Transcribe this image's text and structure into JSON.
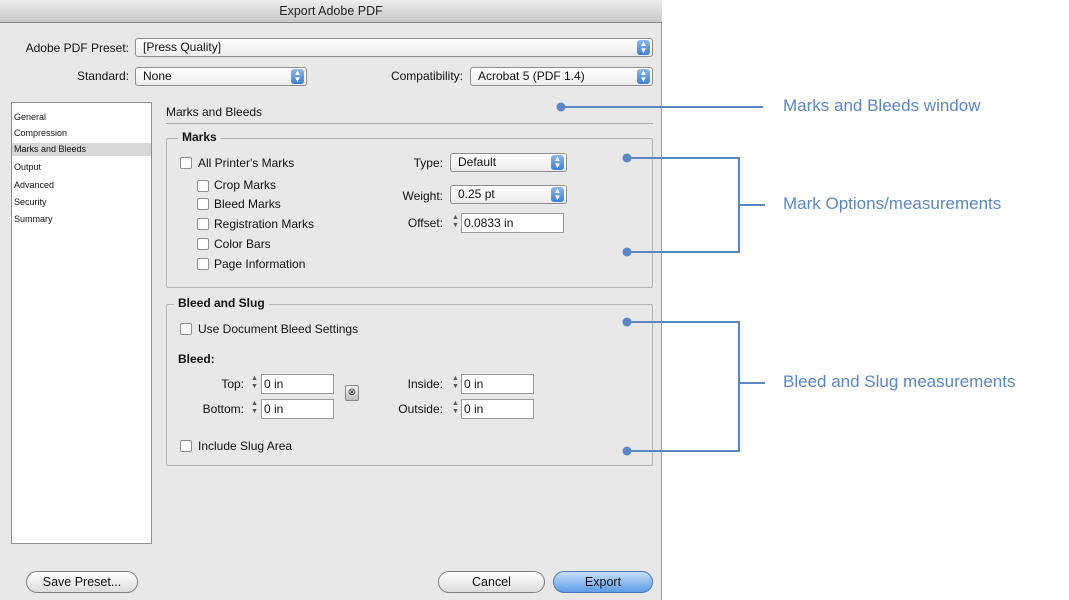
{
  "window": {
    "title": "Export Adobe PDF"
  },
  "preset": {
    "label": "Adobe PDF Preset:",
    "value": "[Press Quality]"
  },
  "standard": {
    "label": "Standard:",
    "value": "None"
  },
  "compatibility": {
    "label": "Compatibility:",
    "value": "Acrobat 5 (PDF 1.4)"
  },
  "sidebar": {
    "items": [
      {
        "label": "General"
      },
      {
        "label": "Compression"
      },
      {
        "label": "Marks and Bleeds"
      },
      {
        "label": "Output"
      },
      {
        "label": "Advanced"
      },
      {
        "label": "Security"
      },
      {
        "label": "Summary"
      }
    ]
  },
  "panel": {
    "title": "Marks and Bleeds"
  },
  "marks": {
    "group_title": "Marks",
    "all_printers_marks": "All Printer's Marks",
    "crop_marks": "Crop Marks",
    "bleed_marks": "Bleed Marks",
    "registration_marks": "Registration Marks",
    "color_bars": "Color Bars",
    "page_information": "Page Information",
    "type_label": "Type:",
    "type_value": "Default",
    "weight_label": "Weight:",
    "weight_value": "0.25 pt",
    "offset_label": "Offset:",
    "offset_value": "0.0833 in"
  },
  "bleed": {
    "group_title": "Bleed and Slug",
    "use_document": "Use Document Bleed Settings",
    "bleed_label": "Bleed:",
    "top_label": "Top:",
    "top_value": "0 in",
    "bottom_label": "Bottom:",
    "bottom_value": "0 in",
    "inside_label": "Inside:",
    "inside_value": "0 in",
    "outside_label": "Outside:",
    "outside_value": "0 in",
    "include_slug": "Include Slug Area"
  },
  "buttons": {
    "save_preset": "Save Preset...",
    "cancel": "Cancel",
    "export": "Export"
  },
  "callouts": {
    "marks_and_bleeds_window": "Marks and Bleeds window",
    "mark_options": "Mark Options/measurements",
    "bleed_slug": "Bleed and Slug measurements",
    "color": "#5b86c4"
  }
}
